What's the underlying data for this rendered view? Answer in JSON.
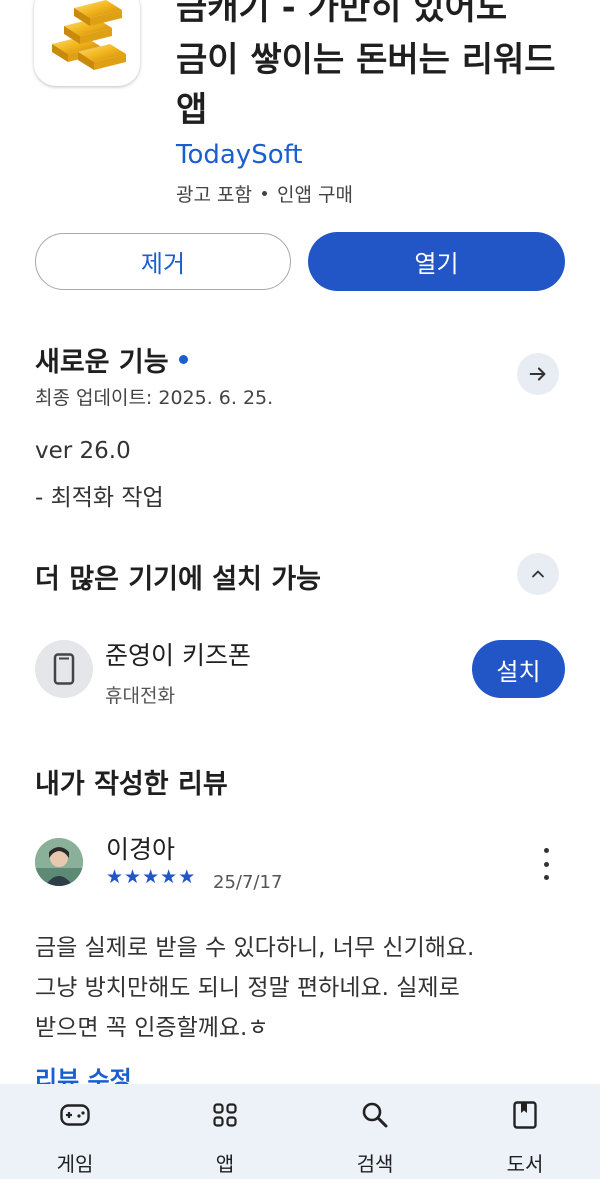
{
  "app": {
    "title_line1": "금캐기 - 가만히 있어도",
    "title_line2": "금이 쌓이는 돈버는 리워드",
    "title_line3": "앱",
    "developer": "TodaySoft",
    "meta_ads": "광고 포함",
    "meta_iap": "인앱 구매",
    "icon": "gold-bars-icon"
  },
  "actions": {
    "remove_label": "제거",
    "open_label": "열기"
  },
  "whats_new": {
    "title": "새로운 기능",
    "last_updated": "최종 업데이트: 2025. 6. 25.",
    "version": "ver 26.0",
    "notes": "- 최적화 작업"
  },
  "devices": {
    "title": "더 많은 기기에 설치 가능",
    "device_name": "준영이 키즈폰",
    "device_type": "휴대전화",
    "install_label": "설치"
  },
  "my_review": {
    "title": "내가 작성한 리뷰",
    "reviewer": "이경아",
    "rating": 5,
    "date": "25/7/17",
    "lines": [
      "금을 실제로 받을 수 있다하니, 너무 신기해요.",
      "그냥 방치만해도 되니 정말 편하네요. 실제로",
      "받으면 꼭 인증할께요.ㅎ"
    ],
    "edit_label": "리뷰 수정"
  },
  "bottom_nav": [
    {
      "label": "게임",
      "icon": "gamepad-icon"
    },
    {
      "label": "앱",
      "icon": "apps-grid-icon"
    },
    {
      "label": "검색",
      "icon": "search-icon"
    },
    {
      "label": "도서",
      "icon": "book-icon"
    }
  ],
  "colors": {
    "accent": "#2256c7",
    "link": "#1a5fd1",
    "nav_bg": "#edf1f8"
  }
}
